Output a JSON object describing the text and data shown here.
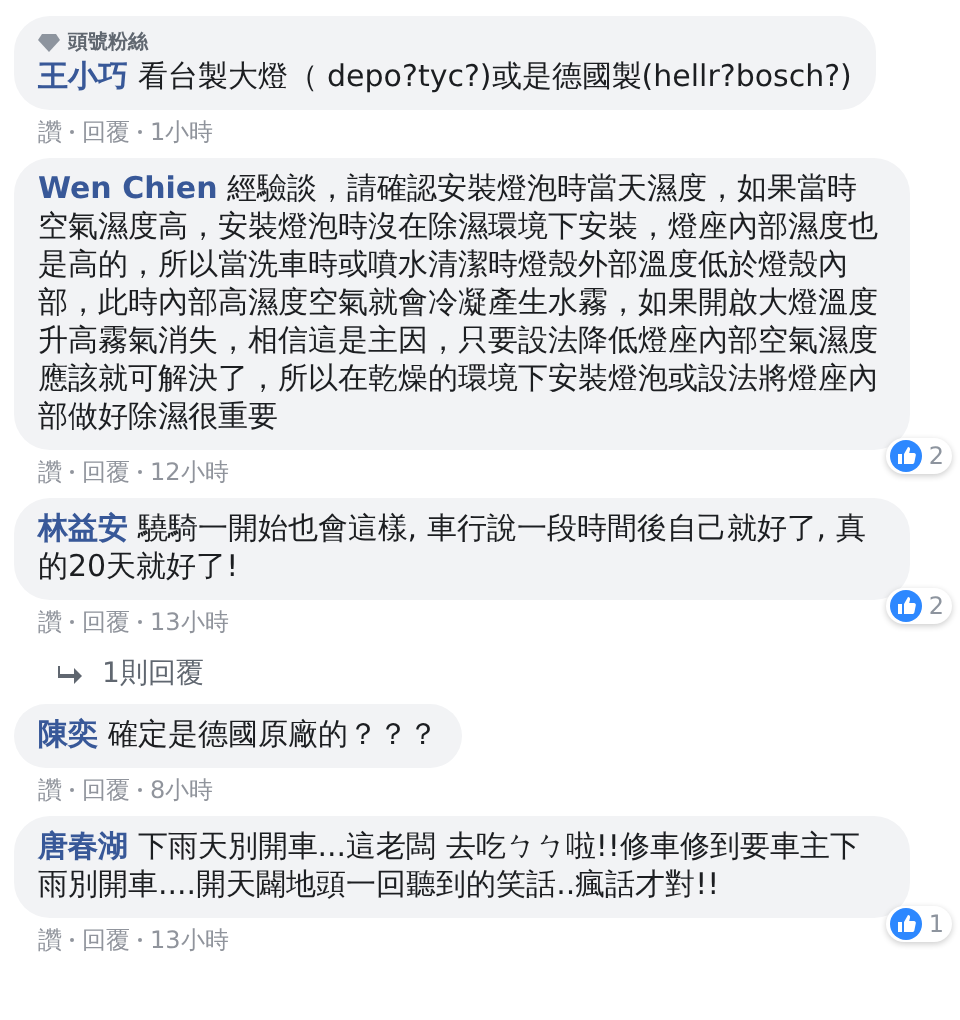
{
  "comments": [
    {
      "badge": "頭號粉絲",
      "author": "王小巧",
      "text": "看台製大燈（ depo?tyc?)或是德國製(hellr?bosch?)",
      "actions": [
        "讚",
        "回覆",
        "1小時"
      ]
    },
    {
      "author": "Wen Chien",
      "text": "經驗談，請確認安裝燈泡時當天濕度，如果當時空氣濕度高，安裝燈泡時沒在除濕環境下安裝，燈座內部濕度也是高的，所以當洗車時或噴水清潔時燈殼外部溫度低於燈殼內部，此時內部高濕度空氣就會冷凝產生水霧，如果開啟大燈溫度升高霧氣消失，相信這是主因，只要設法降低燈座內部空氣濕度應該就可解決了，所以在乾燥的環境下安裝燈泡或設法將燈座內部做好除濕很重要",
      "actions": [
        "讚",
        "回覆",
        "12小時"
      ],
      "reactions": "2"
    },
    {
      "author": "林益安",
      "text": "驍騎一開始也會這樣, 車行說一段時間後自己就好了, 真的20天就好了!",
      "actions": [
        "讚",
        "回覆",
        "13小時"
      ],
      "reactions": "2",
      "replies": "1則回覆"
    },
    {
      "author": "陳奕",
      "text": "確定是德國原廠的？？？",
      "actions": [
        "讚",
        "回覆",
        "8小時"
      ]
    },
    {
      "author": "唐春湖",
      "text": "下雨天別開車...這老闆 去吃ㄅㄅ啦!!修車修到要車主下雨別開車....開天闢地頭一回聽到的笑話..瘋話才對!!",
      "actions": [
        "讚",
        "回覆",
        "13小時"
      ],
      "reactions": "1"
    }
  ]
}
